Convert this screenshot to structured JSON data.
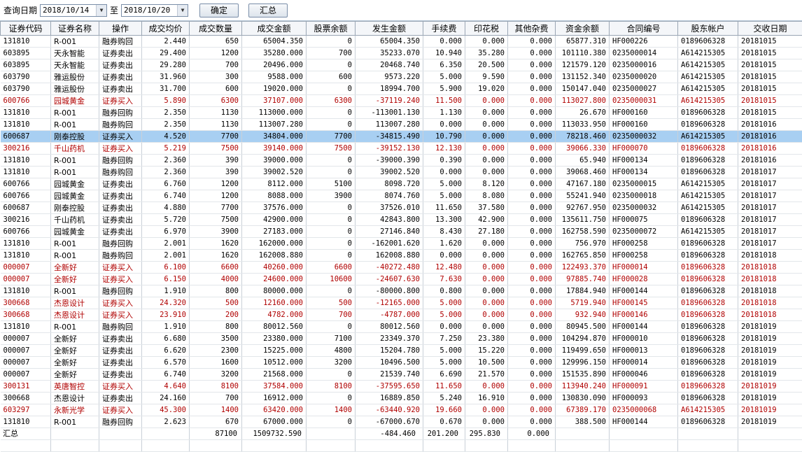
{
  "toolbar": {
    "query_label": "查询日期",
    "date_from": "2018/10/14",
    "to_label": "至",
    "date_to": "2018/10/20",
    "confirm_label": "确定",
    "summary_label": "汇总"
  },
  "columns": [
    "证券代码",
    "证券名称",
    "操作",
    "成交均价",
    "成交数量",
    "成交金额",
    "股票余额",
    "发生金额",
    "手续费",
    "印花税",
    "其他杂费",
    "资金余额",
    "合同编号",
    "股东帐户",
    "交收日期"
  ],
  "rows": [
    {
      "style": "",
      "cells": [
        "131810",
        "R-001",
        "融券购回",
        "2.440",
        "650",
        "65004.350",
        "0",
        "65004.350",
        "0.000",
        "0.000",
        "0.000",
        "65877.310",
        "HF000226",
        "0189606328",
        "20181015"
      ]
    },
    {
      "style": "",
      "cells": [
        "603895",
        "天永智能",
        "证券卖出",
        "29.400",
        "1200",
        "35280.000",
        "700",
        "35233.070",
        "10.940",
        "35.280",
        "0.000",
        "101110.380",
        "0235000014",
        "A614215305",
        "20181015"
      ]
    },
    {
      "style": "",
      "cells": [
        "603895",
        "天永智能",
        "证券卖出",
        "29.280",
        "700",
        "20496.000",
        "0",
        "20468.740",
        "6.350",
        "20.500",
        "0.000",
        "121579.120",
        "0235000016",
        "A614215305",
        "20181015"
      ]
    },
    {
      "style": "",
      "cells": [
        "603790",
        "雅运股份",
        "证券卖出",
        "31.960",
        "300",
        "9588.000",
        "600",
        "9573.220",
        "5.000",
        "9.590",
        "0.000",
        "131152.340",
        "0235000020",
        "A614215305",
        "20181015"
      ]
    },
    {
      "style": "",
      "cells": [
        "603790",
        "雅运股份",
        "证券卖出",
        "31.700",
        "600",
        "19020.000",
        "0",
        "18994.700",
        "5.900",
        "19.020",
        "0.000",
        "150147.040",
        "0235000027",
        "A614215305",
        "20181015"
      ]
    },
    {
      "style": "red",
      "cells": [
        "600766",
        "园城黄金",
        "证券买入",
        "5.890",
        "6300",
        "37107.000",
        "6300",
        "-37119.240",
        "11.500",
        "0.000",
        "0.000",
        "113027.800",
        "0235000031",
        "A614215305",
        "20181015"
      ]
    },
    {
      "style": "",
      "cells": [
        "131810",
        "R-001",
        "融券回购",
        "2.350",
        "1130",
        "113000.000",
        "0",
        "-113001.130",
        "1.130",
        "0.000",
        "0.000",
        "26.670",
        "HF000160",
        "0189606328",
        "20181015"
      ]
    },
    {
      "style": "",
      "cells": [
        "131810",
        "R-001",
        "融券购回",
        "2.350",
        "1130",
        "113007.280",
        "0",
        "113007.280",
        "0.000",
        "0.000",
        "0.000",
        "113033.950",
        "HF000160",
        "0189606328",
        "20181016"
      ]
    },
    {
      "style": "sel",
      "cells": [
        "600687",
        "刚泰控股",
        "证券买入",
        "4.520",
        "7700",
        "34804.000",
        "7700",
        "-34815.490",
        "10.790",
        "0.000",
        "0.000",
        "78218.460",
        "0235000032",
        "A614215305",
        "20181016"
      ]
    },
    {
      "style": "red",
      "cells": [
        "300216",
        "千山药机",
        "证券买入",
        "5.219",
        "7500",
        "39140.000",
        "7500",
        "-39152.130",
        "12.130",
        "0.000",
        "0.000",
        "39066.330",
        "HF000070",
        "0189606328",
        "20181016"
      ]
    },
    {
      "style": "",
      "cells": [
        "131810",
        "R-001",
        "融券回购",
        "2.360",
        "390",
        "39000.000",
        "0",
        "-39000.390",
        "0.390",
        "0.000",
        "0.000",
        "65.940",
        "HF000134",
        "0189606328",
        "20181016"
      ]
    },
    {
      "style": "",
      "cells": [
        "131810",
        "R-001",
        "融券购回",
        "2.360",
        "390",
        "39002.520",
        "0",
        "39002.520",
        "0.000",
        "0.000",
        "0.000",
        "39068.460",
        "HF000134",
        "0189606328",
        "20181017"
      ]
    },
    {
      "style": "",
      "cells": [
        "600766",
        "园城黄金",
        "证券卖出",
        "6.760",
        "1200",
        "8112.000",
        "5100",
        "8098.720",
        "5.000",
        "8.120",
        "0.000",
        "47167.180",
        "0235000015",
        "A614215305",
        "20181017"
      ]
    },
    {
      "style": "",
      "cells": [
        "600766",
        "园城黄金",
        "证券卖出",
        "6.740",
        "1200",
        "8088.000",
        "3900",
        "8074.760",
        "5.000",
        "8.080",
        "0.000",
        "55241.940",
        "0235000018",
        "A614215305",
        "20181017"
      ]
    },
    {
      "style": "",
      "cells": [
        "600687",
        "刚泰控股",
        "证券卖出",
        "4.880",
        "7700",
        "37576.000",
        "0",
        "37526.010",
        "11.650",
        "37.580",
        "0.000",
        "92767.950",
        "0235000032",
        "A614215305",
        "20181017"
      ]
    },
    {
      "style": "",
      "cells": [
        "300216",
        "千山药机",
        "证券卖出",
        "5.720",
        "7500",
        "42900.000",
        "0",
        "42843.800",
        "13.300",
        "42.900",
        "0.000",
        "135611.750",
        "HF000075",
        "0189606328",
        "20181017"
      ]
    },
    {
      "style": "",
      "cells": [
        "600766",
        "园城黄金",
        "证券卖出",
        "6.970",
        "3900",
        "27183.000",
        "0",
        "27146.840",
        "8.430",
        "27.180",
        "0.000",
        "162758.590",
        "0235000072",
        "A614215305",
        "20181017"
      ]
    },
    {
      "style": "",
      "cells": [
        "131810",
        "R-001",
        "融券回购",
        "2.001",
        "1620",
        "162000.000",
        "0",
        "-162001.620",
        "1.620",
        "0.000",
        "0.000",
        "756.970",
        "HF000258",
        "0189606328",
        "20181017"
      ]
    },
    {
      "style": "",
      "cells": [
        "131810",
        "R-001",
        "融券购回",
        "2.001",
        "1620",
        "162008.880",
        "0",
        "162008.880",
        "0.000",
        "0.000",
        "0.000",
        "162765.850",
        "HF000258",
        "0189606328",
        "20181018"
      ]
    },
    {
      "style": "red",
      "cells": [
        "000007",
        "全新好",
        "证券买入",
        "6.100",
        "6600",
        "40260.000",
        "6600",
        "-40272.480",
        "12.480",
        "0.000",
        "0.000",
        "122493.370",
        "HF000014",
        "0189606328",
        "20181018"
      ]
    },
    {
      "style": "red",
      "cells": [
        "000007",
        "全新好",
        "证券买入",
        "6.150",
        "4000",
        "24600.000",
        "10600",
        "-24607.630",
        "7.630",
        "0.000",
        "0.000",
        "97885.740",
        "HF000028",
        "0189606328",
        "20181018"
      ]
    },
    {
      "style": "",
      "cells": [
        "131810",
        "R-001",
        "融券回购",
        "1.910",
        "800",
        "80000.000",
        "0",
        "-80000.800",
        "0.800",
        "0.000",
        "0.000",
        "17884.940",
        "HF000144",
        "0189606328",
        "20181018"
      ]
    },
    {
      "style": "red",
      "cells": [
        "300668",
        "杰恩设计",
        "证券买入",
        "24.320",
        "500",
        "12160.000",
        "500",
        "-12165.000",
        "5.000",
        "0.000",
        "0.000",
        "5719.940",
        "HF000145",
        "0189606328",
        "20181018"
      ]
    },
    {
      "style": "red",
      "cells": [
        "300668",
        "杰恩设计",
        "证券买入",
        "23.910",
        "200",
        "4782.000",
        "700",
        "-4787.000",
        "5.000",
        "0.000",
        "0.000",
        "932.940",
        "HF000146",
        "0189606328",
        "20181018"
      ]
    },
    {
      "style": "",
      "cells": [
        "131810",
        "R-001",
        "融券购回",
        "1.910",
        "800",
        "80012.560",
        "0",
        "80012.560",
        "0.000",
        "0.000",
        "0.000",
        "80945.500",
        "HF000144",
        "0189606328",
        "20181019"
      ]
    },
    {
      "style": "",
      "cells": [
        "000007",
        "全新好",
        "证券卖出",
        "6.680",
        "3500",
        "23380.000",
        "7100",
        "23349.370",
        "7.250",
        "23.380",
        "0.000",
        "104294.870",
        "HF000010",
        "0189606328",
        "20181019"
      ]
    },
    {
      "style": "",
      "cells": [
        "000007",
        "全新好",
        "证券卖出",
        "6.620",
        "2300",
        "15225.000",
        "4800",
        "15204.780",
        "5.000",
        "15.220",
        "0.000",
        "119499.650",
        "HF000013",
        "0189606328",
        "20181019"
      ]
    },
    {
      "style": "",
      "cells": [
        "000007",
        "全新好",
        "证券卖出",
        "6.570",
        "1600",
        "10512.000",
        "3200",
        "10496.500",
        "5.000",
        "10.500",
        "0.000",
        "129996.150",
        "HF000014",
        "0189606328",
        "20181019"
      ]
    },
    {
      "style": "",
      "cells": [
        "000007",
        "全新好",
        "证券卖出",
        "6.740",
        "3200",
        "21568.000",
        "0",
        "21539.740",
        "6.690",
        "21.570",
        "0.000",
        "151535.890",
        "HF000046",
        "0189606328",
        "20181019"
      ]
    },
    {
      "style": "red",
      "cells": [
        "300131",
        "英唐智控",
        "证券买入",
        "4.640",
        "8100",
        "37584.000",
        "8100",
        "-37595.650",
        "11.650",
        "0.000",
        "0.000",
        "113940.240",
        "HF000091",
        "0189606328",
        "20181019"
      ]
    },
    {
      "style": "",
      "cells": [
        "300668",
        "杰恩设计",
        "证券卖出",
        "24.160",
        "700",
        "16912.000",
        "0",
        "16889.850",
        "5.240",
        "16.910",
        "0.000",
        "130830.090",
        "HF000093",
        "0189606328",
        "20181019"
      ]
    },
    {
      "style": "red",
      "cells": [
        "603297",
        "永新光学",
        "证券买入",
        "45.300",
        "1400",
        "63420.000",
        "1400",
        "-63440.920",
        "19.660",
        "0.000",
        "0.000",
        "67389.170",
        "0235000068",
        "A614215305",
        "20181019"
      ]
    },
    {
      "style": "",
      "cells": [
        "131810",
        "R-001",
        "融券回购",
        "2.623",
        "670",
        "67000.000",
        "0",
        "-67000.670",
        "0.670",
        "0.000",
        "0.000",
        "388.500",
        "HF000144",
        "0189606328",
        "20181019"
      ]
    }
  ],
  "summary": {
    "label": "汇总",
    "qty": "87100",
    "amount": "1509732.590",
    "occur": "-484.460",
    "fee": "201.200",
    "stamp": "295.830",
    "other": "0.000"
  }
}
